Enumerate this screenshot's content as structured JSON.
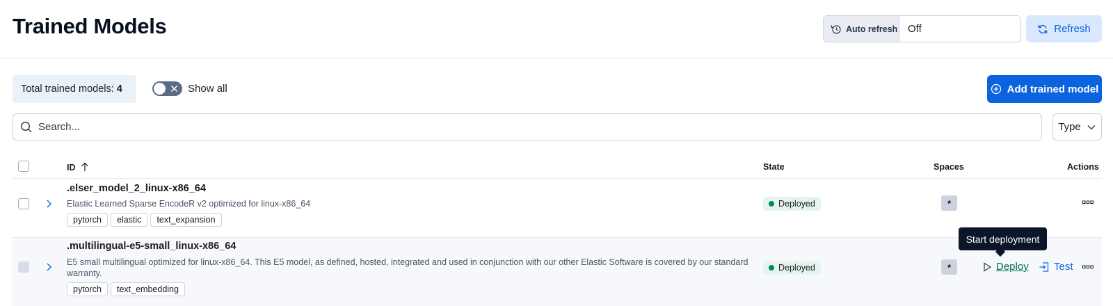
{
  "header": {
    "title": "Trained Models",
    "auto_refresh_label": "Auto refresh",
    "auto_refresh_value": "Off",
    "refresh_label": "Refresh"
  },
  "toolbar": {
    "total_label": "Total trained models:",
    "total_count": "4",
    "show_all_label": "Show all",
    "add_model_label": "Add trained model"
  },
  "search": {
    "placeholder": "Search...",
    "type_filter_label": "Type"
  },
  "table": {
    "columns": {
      "id": "ID",
      "state": "State",
      "spaces": "Spaces",
      "actions": "Actions"
    },
    "rows": [
      {
        "id": ".elser_model_2_linux-x86_64",
        "description": "Elastic Learned Sparse EncodeR v2 optimized for linux-x86_64",
        "tags": [
          "pytorch",
          "elastic",
          "text_expansion"
        ],
        "state": "Deployed",
        "spaces": "*"
      },
      {
        "id": ".multilingual-e5-small_linux-x86_64",
        "description": "E5 small multilingual optimized for linux-x86_64. This E5 model, as defined, hosted, integrated and used in conjunction with our other Elastic Software is covered by our standard warranty.",
        "tags": [
          "pytorch",
          "text_embedding"
        ],
        "state": "Deployed",
        "spaces": "*",
        "deploy_label": "Deploy",
        "test_label": "Test"
      }
    ]
  },
  "tooltip": {
    "text": "Start deployment"
  },
  "colors": {
    "primary": "#0b64dd",
    "success": "#008a5e",
    "deploy_link": "#006c4e",
    "tooltip_bg": "#0b1628"
  }
}
